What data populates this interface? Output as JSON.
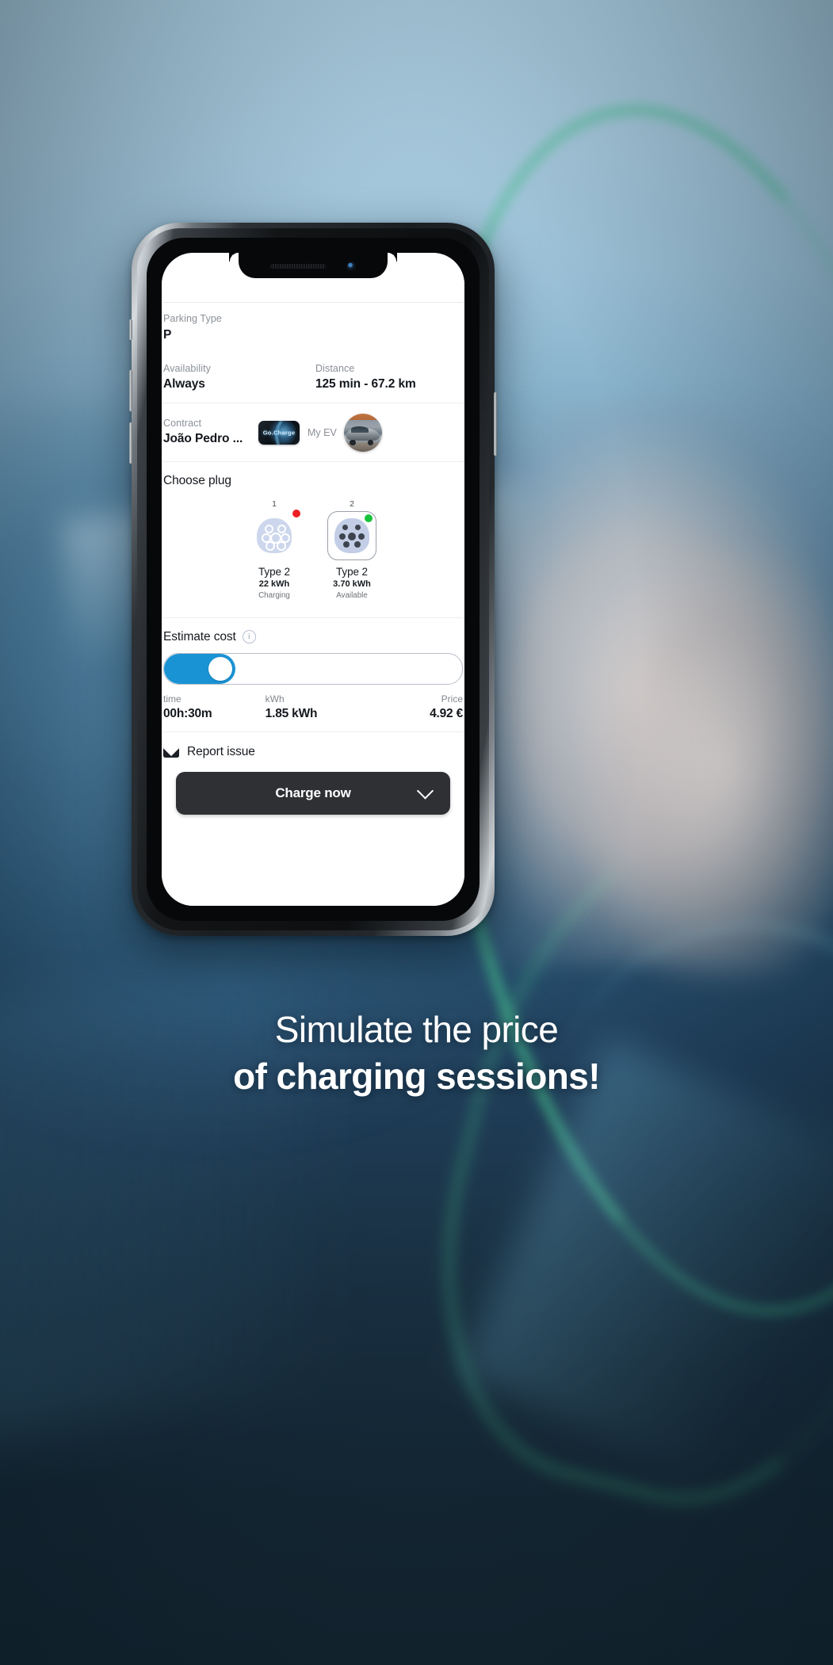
{
  "background": {
    "top_color": "#a9cbdd",
    "bottom_color": "#142530",
    "accent_cable_color": "#46be8c"
  },
  "phone": {
    "notch": {
      "speaker_name": "speaker-grille",
      "camera_name": "front-camera"
    }
  },
  "app": {
    "details": {
      "parking": {
        "label": "Parking Type",
        "value": "P"
      },
      "availability": {
        "label": "Availability",
        "value": "Always"
      },
      "distance": {
        "label": "Distance",
        "value": "125 min - 67.2 km"
      },
      "contract": {
        "label": "Contract",
        "value": "João Pedro ..."
      },
      "provider_logo_text": "Go.Charge",
      "my_ev": {
        "label": "My EV"
      }
    },
    "plugs": {
      "title": "Choose plug",
      "items": [
        {
          "number": "1",
          "name": "Type 2",
          "power": "22 kWh",
          "status": "Charging",
          "status_color": "#ec1f25",
          "selected": false
        },
        {
          "number": "2",
          "name": "Type 2",
          "power": "3.70 kWh",
          "status": "Available",
          "status_color": "#19c23c",
          "selected": true
        }
      ]
    },
    "estimate": {
      "title": "Estimate cost",
      "info_icon_label": "i",
      "slider": {
        "fill_percent": "24",
        "accent_color": "#1a93d4"
      },
      "time": {
        "label": "time",
        "value": "00h:30m"
      },
      "energy": {
        "label": "kWh",
        "value": "1.85 kWh"
      },
      "price": {
        "label": "Price",
        "value": "4.92 €"
      }
    },
    "report": {
      "label": "Report issue"
    },
    "cta": {
      "label": "Charge now"
    }
  },
  "caption": {
    "line1": "Simulate the price",
    "line2": "of charging sessions!"
  }
}
